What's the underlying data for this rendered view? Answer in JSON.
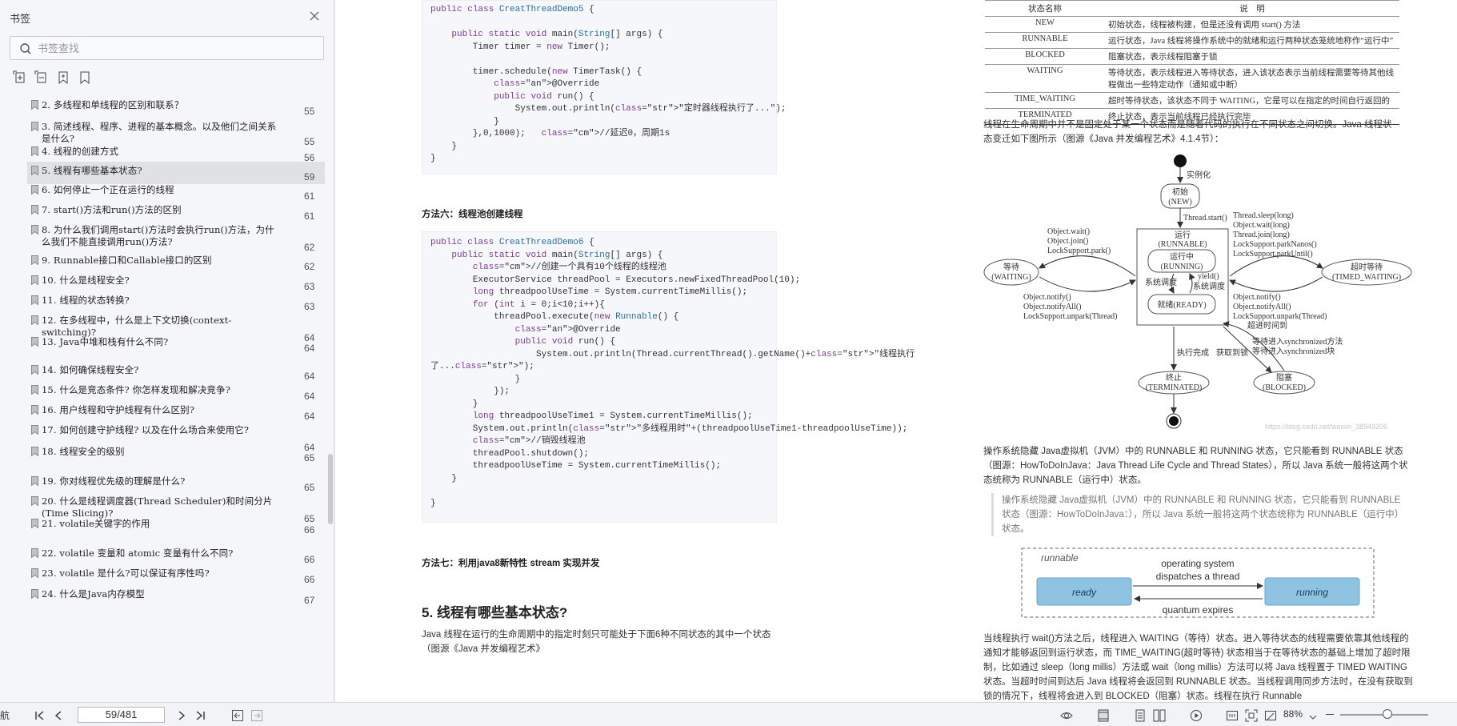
{
  "sidebar": {
    "title": "书签",
    "search_placeholder": "书签查找",
    "items": [
      {
        "label": "2. 多线程和单线程的区别和联系？",
        "page": "55"
      },
      {
        "label": "3. 简述线程、程序、进程的基本概念。以及他们之间关系是什么?",
        "page": "55"
      },
      {
        "label": "4. 线程的创建方式",
        "page": "56"
      },
      {
        "label": "5. 线程有哪些基本状态?",
        "page": "59"
      },
      {
        "label": "6. 如何停止一个正在运行的线程",
        "page": "61"
      },
      {
        "label": "7. start()方法和run()方法的区别",
        "page": "61"
      },
      {
        "label": "8. 为什么我们调用start()方法时会执行run()方法，为什么我们不能直接调用run()方法?",
        "page": "62"
      },
      {
        "label": "9. Runnable接口和Callable接口的区别",
        "page": "62"
      },
      {
        "label": "10. 什么是线程安全?",
        "page": "63"
      },
      {
        "label": "11. 线程的状态转换?",
        "page": "63"
      },
      {
        "label": "12. 在多线程中，什么是上下文切换(context-switching)?",
        "page": "64"
      },
      {
        "label": "13. Java中堆和栈有什么不同?",
        "page": "64"
      },
      {
        "label": "14. 如何确保线程安全?",
        "page": "64"
      },
      {
        "label": "15. 什么是竞态条件? 你怎样发现和解决竞争?",
        "page": "64"
      },
      {
        "label": "16. 用户线程和守护线程有什么区别?",
        "page": "64"
      },
      {
        "label": "17. 如何创建守护线程? 以及在什么场合来使用它?",
        "page": "64"
      },
      {
        "label": "18. 线程安全的级别",
        "page": "65"
      },
      {
        "label": "19. 你对线程优先级的理解是什么?",
        "page": "65"
      },
      {
        "label": "20. 什么是线程调度器(Thread Scheduler)和时间分片(Time Slicing)?",
        "page": "65"
      },
      {
        "label": "21. volatile关键字的作用",
        "page": "66"
      },
      {
        "label": "22. volatile 变量和 atomic 变量有什么不同?",
        "page": "66"
      },
      {
        "label": "23. volatile 是什么?可以保证有序性吗?",
        "page": "66"
      },
      {
        "label": "24. 什么是Java内存模型",
        "page": "67"
      }
    ]
  },
  "doc": {
    "code1": [
      "public class CreatThreadDemo5 {",
      "",
      "    public static void main(String[] args) {",
      "        Timer timer = new Timer();",
      "",
      "        timer.schedule(new TimerTask() {",
      "            @Override",
      "            public void run() {",
      "                System.out.println(\"定时器线程执行了...\");",
      "            }",
      "        },0,1000);   //延迟0，周期1s",
      "    }",
      "}"
    ],
    "heading6": "方法六：线程池创建线程",
    "code2": [
      "public class CreatThreadDemo6 {",
      "    public static void main(String[] args) {",
      "        //创建一个具有10个线程的线程池",
      "        ExecutorService threadPool = Executors.newFixedThreadPool(10);",
      "        long threadpoolUseTime = System.currentTimeMillis();",
      "        for (int i = 0;i<10;i++){",
      "            threadPool.execute(new Runnable() {",
      "                @Override",
      "                public void run() {",
      "                    System.out.println(Thread.currentThread().getName()+\"线程执行",
      "了...\");",
      "                }",
      "            });",
      "        }",
      "        long threadpoolUseTime1 = System.currentTimeMillis();",
      "        System.out.println(\"多线程用时\"+(threadpoolUseTime1-threadpoolUseTime));",
      "        //销毁线程池",
      "        threadPool.shutdown();",
      "        threadpoolUseTime = System.currentTimeMillis();",
      "    }",
      "",
      "}"
    ],
    "heading7": "方法七：利用java8新特性 stream 实现并发",
    "section_title": "5. 线程有哪些基本状态?",
    "section_para": "Java 线程在运行的生命周期中的指定时刻只可能处于下面6种不同状态的其中一个状态（图源《Java 并发编程艺术》",
    "table": {
      "headers": [
        "状态名称",
        "说　明"
      ],
      "rows": [
        [
          "NEW",
          "初始状态，线程被构建，但是还没有调用 start() 方法"
        ],
        [
          "RUNNABLE",
          "运行状态，Java 线程将操作系统中的就绪和运行两种状态笼统地称作“运行中”"
        ],
        [
          "BLOCKED",
          "阻塞状态，表示线程阻塞于锁"
        ],
        [
          "WAITING",
          "等待状态，表示线程进入等待状态，进入该状态表示当前线程需要等待其他线程做出一些特定动作（通知或中断）"
        ],
        [
          "TIME_WAITING",
          "超时等待状态，该状态不同于 WAITING，它是可以在指定的时间自行返回的"
        ],
        [
          "TERMINATED",
          "终止状态，表示当前线程已经执行完毕"
        ]
      ]
    },
    "para_right1": "线程在生命周期中并不是固定处于某一个状态而是随着代码的执行在不同状态之间切换。Java 线程状态变迁如下图所示（图源《Java 并发编程艺术》4.1.4节）：",
    "diagram": {
      "instantiate": "实例化",
      "init": "初始",
      "init_en": "(NEW)",
      "thread_start": "Thread.start()",
      "run": "运行",
      "run_en": "(RUNNABLE)",
      "running": "运行中",
      "running_en": "(RUNNING)",
      "yield": "yield()",
      "os_schedule_l": "系统调度",
      "os_schedule_r": "系统调度",
      "ready": "就绪(READY)",
      "waiting": "等待",
      "waiting_en": "(WAITING)",
      "timed_waiting": "超时等待",
      "timed_waiting_en": "(TIMED_WAITING)",
      "to_wait": [
        "Object.wait()",
        "Object.join()",
        "LockSupport.park()"
      ],
      "from_wait": [
        "Object.notify()",
        "Object.notifyAll()",
        "LockSupport.unpark(Thread)"
      ],
      "to_timed": [
        "Thread.sleep(long)",
        "Object.wait(long)",
        "Thread.join(long)",
        "LockSupport.parkNanos()",
        "LockSupport.parkUntil()"
      ],
      "from_timed": [
        "Object.notify()",
        "Object.notifyAll()",
        "LockSupport.unpark(Thread)",
        "超进时间到"
      ],
      "sync_wait": [
        "等待进入synchronized方法",
        "等待进入synchronized块"
      ],
      "done": "执行完成",
      "get_lock": "获取到锁",
      "terminated": "终止",
      "terminated_en": "(TERMINATED)",
      "blocked": "阻塞",
      "blocked_en": "(BLOCKED)",
      "watermark": "https://blog.csdn.net/weixin_38949206"
    },
    "para_right2": "操作系统隐藏 Java虚拟机（JVM）中的 RUNNABLE 和 RUNNING 状态，它只能看到 RUNNABLE 状态（图源：HowToDoInJava：Java Thread Life Cycle and Thread States），所以 Java 系统一般将这两个状态统称为 RUNNABLE（运行中）状态。",
    "quote": "操作系统隐藏 Java虚拟机（JVM）中的 RUNNABLE 和 RUNNING 状态，它只能看到 RUNNABLE 状态（图源：HowToDoInJava：），所以 Java 系统一般将这两个状态统称为 RUNNABLE（运行中）状态。",
    "runnable_diagram": {
      "label": "runnable",
      "ready": "ready",
      "running": "running",
      "top_line1": "operating system",
      "top_line2": "dispatches a thread",
      "bottom": "quantum expires"
    },
    "para_right3": "当线程执行 wait()方法之后，线程进入 WAITING（等待）状态。进入等待状态的线程需要依靠其他线程的通知才能够返回到运行状态，而 TIME_WAITING(超时等待) 状态相当于在等待状态的基础上增加了超时限制，比如通过 sleep（long millis）方法或 wait（long millis）方法可以将 Java 线程置于 TIMED WAITING 状态。当超时时间到达后 Java 线程将会返回到 RUNNABLE 状态。当线程调用同步方法时，在没有获取到锁的情况下，线程将会进入到 BLOCKED（阻塞）状态。线程在执行 Runnable"
  },
  "statusbar": {
    "left_label": "航",
    "page_indicator": "59/481",
    "zoom": "88%"
  }
}
